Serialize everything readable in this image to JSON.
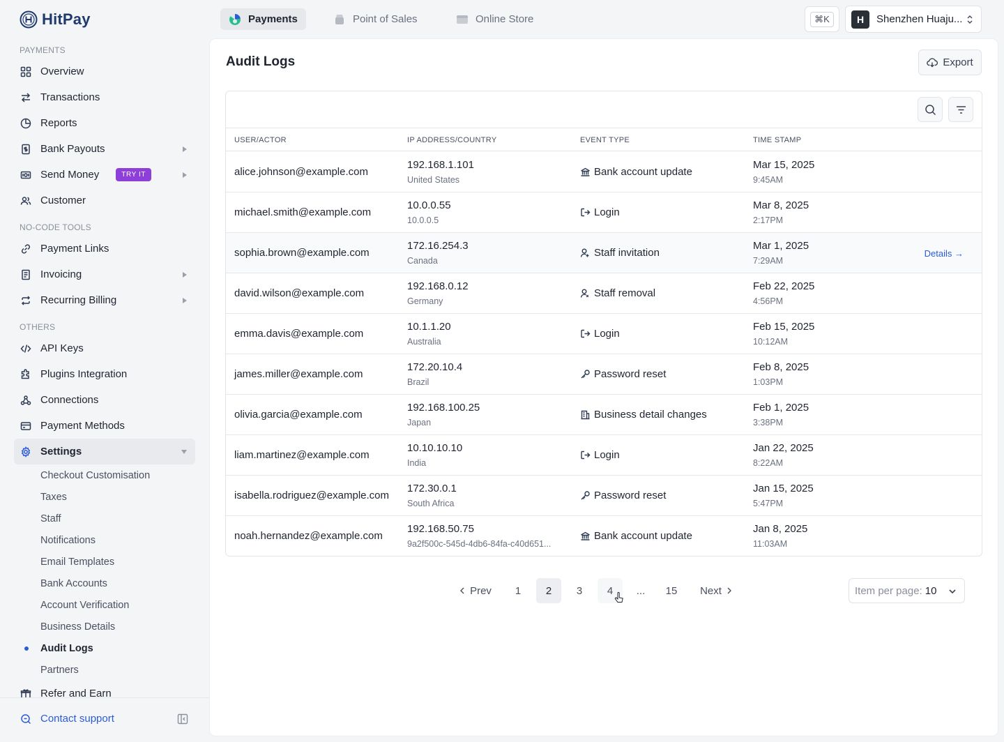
{
  "brand": {
    "name": "HitPay"
  },
  "sidebar": {
    "sections": [
      {
        "title": "PAYMENTS"
      },
      {
        "title": "NO-CODE TOOLS"
      },
      {
        "title": "OTHERS"
      }
    ],
    "items": {
      "overview": "Overview",
      "transactions": "Transactions",
      "reports": "Reports",
      "bank_payouts": "Bank Payouts",
      "send_money": "Send Money",
      "send_money_badge": "TRY IT",
      "customer": "Customer",
      "payment_links": "Payment Links",
      "invoicing": "Invoicing",
      "recurring_billing": "Recurring Billing",
      "api_keys": "API Keys",
      "plugins_integration": "Plugins Integration",
      "connections": "Connections",
      "payment_methods": "Payment Methods",
      "settings": "Settings",
      "refer_and_earn": "Refer and Earn"
    },
    "settings_subitems": [
      "Checkout Customisation",
      "Taxes",
      "Staff",
      "Notifications",
      "Email Templates",
      "Bank Accounts",
      "Account Verification",
      "Business Details",
      "Audit Logs",
      "Partners"
    ],
    "current_subitem": "Audit Logs",
    "contact_support": "Contact support"
  },
  "topbar": {
    "tabs": [
      {
        "label": "Payments",
        "active": true
      },
      {
        "label": "Point of Sales",
        "active": false
      },
      {
        "label": "Online Store",
        "active": false
      }
    ],
    "shortcut": "⌘K",
    "account_initial": "H",
    "account_name": "Shenzhen Huaju..."
  },
  "main": {
    "title": "Audit Logs",
    "export_label": "Export",
    "columns": [
      "USER/ACTOR",
      "IP ADDRESS/COUNTRY",
      "EVENT TYPE",
      "TIME STAMP"
    ],
    "details_label": "Details →",
    "rows": [
      {
        "actor": "alice.johnson@example.com",
        "ip": "192.168.1.101",
        "country": "United States",
        "event": "Bank account update",
        "event_icon": "bank-icon",
        "date": "Mar 15, 2025",
        "time": "9:45AM"
      },
      {
        "actor": "michael.smith@example.com",
        "ip": "10.0.0.55",
        "country": "10.0.0.5",
        "event": "Login",
        "event_icon": "login-icon",
        "date": "Mar 8, 2025",
        "time": "2:17PM"
      },
      {
        "actor": "sophia.brown@example.com",
        "ip": "172.16.254.3",
        "country": "Canada",
        "event": "Staff invitation",
        "event_icon": "user-add-icon",
        "date": "Mar 1, 2025",
        "time": "7:29AM"
      },
      {
        "actor": "david.wilson@example.com",
        "ip": "192.168.0.12",
        "country": "Germany",
        "event": "Staff removal",
        "event_icon": "user-remove-icon",
        "date": "Feb 22, 2025",
        "time": "4:56PM"
      },
      {
        "actor": "emma.davis@example.com",
        "ip": "10.1.1.20",
        "country": "Australia",
        "event": "Login",
        "event_icon": "login-icon",
        "date": "Feb 15, 2025",
        "time": "10:12AM"
      },
      {
        "actor": "james.miller@example.com",
        "ip": "172.20.10.4",
        "country": "Brazil",
        "event": "Password reset",
        "event_icon": "key-icon",
        "date": "Feb 8, 2025",
        "time": "1:03PM"
      },
      {
        "actor": "olivia.garcia@example.com",
        "ip": "192.168.100.25",
        "country": "Japan",
        "event": "Business detail changes",
        "event_icon": "building-icon",
        "date": "Feb 1, 2025",
        "time": "3:38PM"
      },
      {
        "actor": "liam.martinez@example.com",
        "ip": "10.10.10.10",
        "country": "India",
        "event": "Login",
        "event_icon": "login-icon",
        "date": "Jan 22, 2025",
        "time": "8:22AM"
      },
      {
        "actor": "isabella.rodriguez@example.com",
        "ip": "172.30.0.1",
        "country": "South Africa",
        "event": "Password reset",
        "event_icon": "key-icon",
        "date": "Jan 15, 2025",
        "time": "5:47PM"
      },
      {
        "actor": "noah.hernandez@example.com",
        "ip": "192.168.50.75",
        "country": "9a2f500c-545d-4db6-84fa-c40d651...",
        "event": "Bank account update",
        "event_icon": "bank-icon",
        "date": "Jan 8, 2025",
        "time": "11:03AM"
      }
    ],
    "pagination": {
      "prev": "Prev",
      "next": "Next",
      "pages": [
        "1",
        "2",
        "3",
        "4",
        "...",
        "15"
      ],
      "current_page": "2",
      "per_page_label": "Item per page:",
      "per_page_value": "10"
    }
  },
  "colors": {
    "accent": "#2a5bd7",
    "badge": "#8f3fd9",
    "background": "#f4f5f7"
  }
}
